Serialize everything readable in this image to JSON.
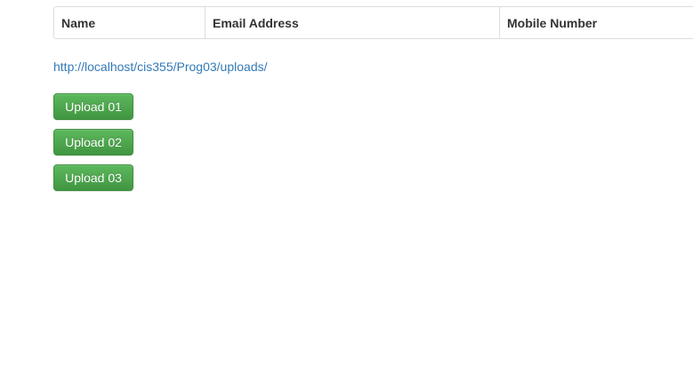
{
  "table": {
    "headers": [
      "Name",
      "Email Address",
      "Mobile Number"
    ]
  },
  "link": {
    "text": "http://localhost/cis355/Prog03/uploads/"
  },
  "buttons": [
    {
      "label": "Upload 01"
    },
    {
      "label": "Upload 02"
    },
    {
      "label": "Upload 03"
    }
  ],
  "colors": {
    "button_green": "#5cb85c",
    "link_blue": "#337ab7",
    "border_gray": "#dddddd"
  }
}
